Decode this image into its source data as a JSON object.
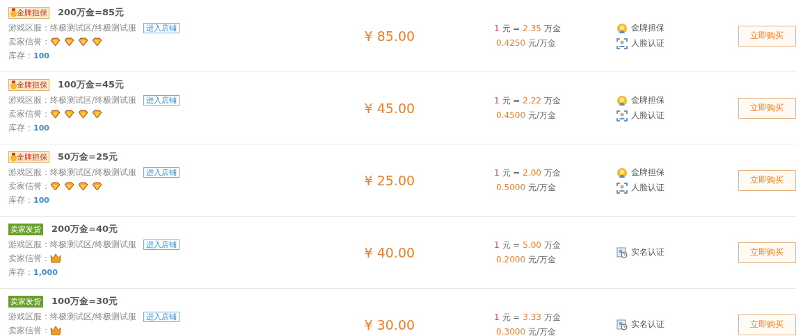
{
  "listings": [
    {
      "badge": {
        "kind": "gold",
        "label": "金牌担保"
      },
      "title": "200万金=85元",
      "server_label": "游戏区服：",
      "server": "终极测试区/终极测试服",
      "shop_link": "进入店铺",
      "reputation_label": "卖家信誉：",
      "reputation": [
        {
          "kind": "diamond"
        },
        {
          "kind": "diamond"
        },
        {
          "kind": "diamond"
        },
        {
          "kind": "diamond"
        }
      ],
      "stock_label": "库存：",
      "stock": "100",
      "price": "¥ 85.00",
      "rate": {
        "one": "1",
        "yuan": "元 =",
        "amount": "2.35",
        "unit": "万金"
      },
      "unit_price": {
        "amount": "0.4250",
        "unit": "元/万金"
      },
      "guarantees": [
        {
          "kind": "gold",
          "label": "金牌担保"
        },
        {
          "kind": "face",
          "label": "人脸认证"
        }
      ],
      "buy_button": "立即购买"
    },
    {
      "badge": {
        "kind": "gold",
        "label": "金牌担保"
      },
      "title": "100万金=45元",
      "server_label": "游戏区服：",
      "server": "终极测试区/终极测试服",
      "shop_link": "进入店铺",
      "reputation_label": "卖家信誉：",
      "reputation": [
        {
          "kind": "diamond"
        },
        {
          "kind": "diamond"
        },
        {
          "kind": "diamond"
        },
        {
          "kind": "diamond"
        }
      ],
      "stock_label": "库存：",
      "stock": "100",
      "price": "¥ 45.00",
      "rate": {
        "one": "1",
        "yuan": "元 =",
        "amount": "2.22",
        "unit": "万金"
      },
      "unit_price": {
        "amount": "0.4500",
        "unit": "元/万金"
      },
      "guarantees": [
        {
          "kind": "gold",
          "label": "金牌担保"
        },
        {
          "kind": "face",
          "label": "人脸认证"
        }
      ],
      "buy_button": "立即购买"
    },
    {
      "badge": {
        "kind": "gold",
        "label": "金牌担保"
      },
      "title": "50万金=25元",
      "server_label": "游戏区服：",
      "server": "终极测试区/终极测试服",
      "shop_link": "进入店铺",
      "reputation_label": "卖家信誉：",
      "reputation": [
        {
          "kind": "diamond"
        },
        {
          "kind": "diamond"
        },
        {
          "kind": "diamond"
        },
        {
          "kind": "diamond"
        }
      ],
      "stock_label": "库存：",
      "stock": "100",
      "price": "¥ 25.00",
      "rate": {
        "one": "1",
        "yuan": "元 =",
        "amount": "2.00",
        "unit": "万金"
      },
      "unit_price": {
        "amount": "0.5000",
        "unit": "元/万金"
      },
      "guarantees": [
        {
          "kind": "gold",
          "label": "金牌担保"
        },
        {
          "kind": "face",
          "label": "人脸认证"
        }
      ],
      "buy_button": "立即购买"
    },
    {
      "badge": {
        "kind": "seller",
        "label": "卖家发货"
      },
      "title": "200万金=40元",
      "server_label": "游戏区服：",
      "server": "终极测试区/终极测试服",
      "shop_link": "进入店铺",
      "reputation_label": "卖家信誉：",
      "reputation": [
        {
          "kind": "crown"
        }
      ],
      "stock_label": "库存：",
      "stock": "1,000",
      "price": "¥ 40.00",
      "rate": {
        "one": "1",
        "yuan": "元 =",
        "amount": "5.00",
        "unit": "万金"
      },
      "unit_price": {
        "amount": "0.2000",
        "unit": "元/万金"
      },
      "guarantees": [
        {
          "kind": "realname",
          "label": "实名认证"
        }
      ],
      "buy_button": "立即购买"
    },
    {
      "badge": {
        "kind": "seller",
        "label": "卖家发货"
      },
      "title": "100万金=30元",
      "server_label": "游戏区服：",
      "server": "终极测试区/终极测试服",
      "shop_link": "进入店铺",
      "reputation_label": "卖家信誉：",
      "reputation": [
        {
          "kind": "crown"
        }
      ],
      "price": "¥ 30.00",
      "rate": {
        "one": "1",
        "yuan": "元 =",
        "amount": "3.33",
        "unit": "万金"
      },
      "unit_price": {
        "amount": "0.3000",
        "unit": "元/万金"
      },
      "guarantees": [
        {
          "kind": "realname",
          "label": "实名认证"
        }
      ],
      "buy_button": "立即购买"
    }
  ]
}
